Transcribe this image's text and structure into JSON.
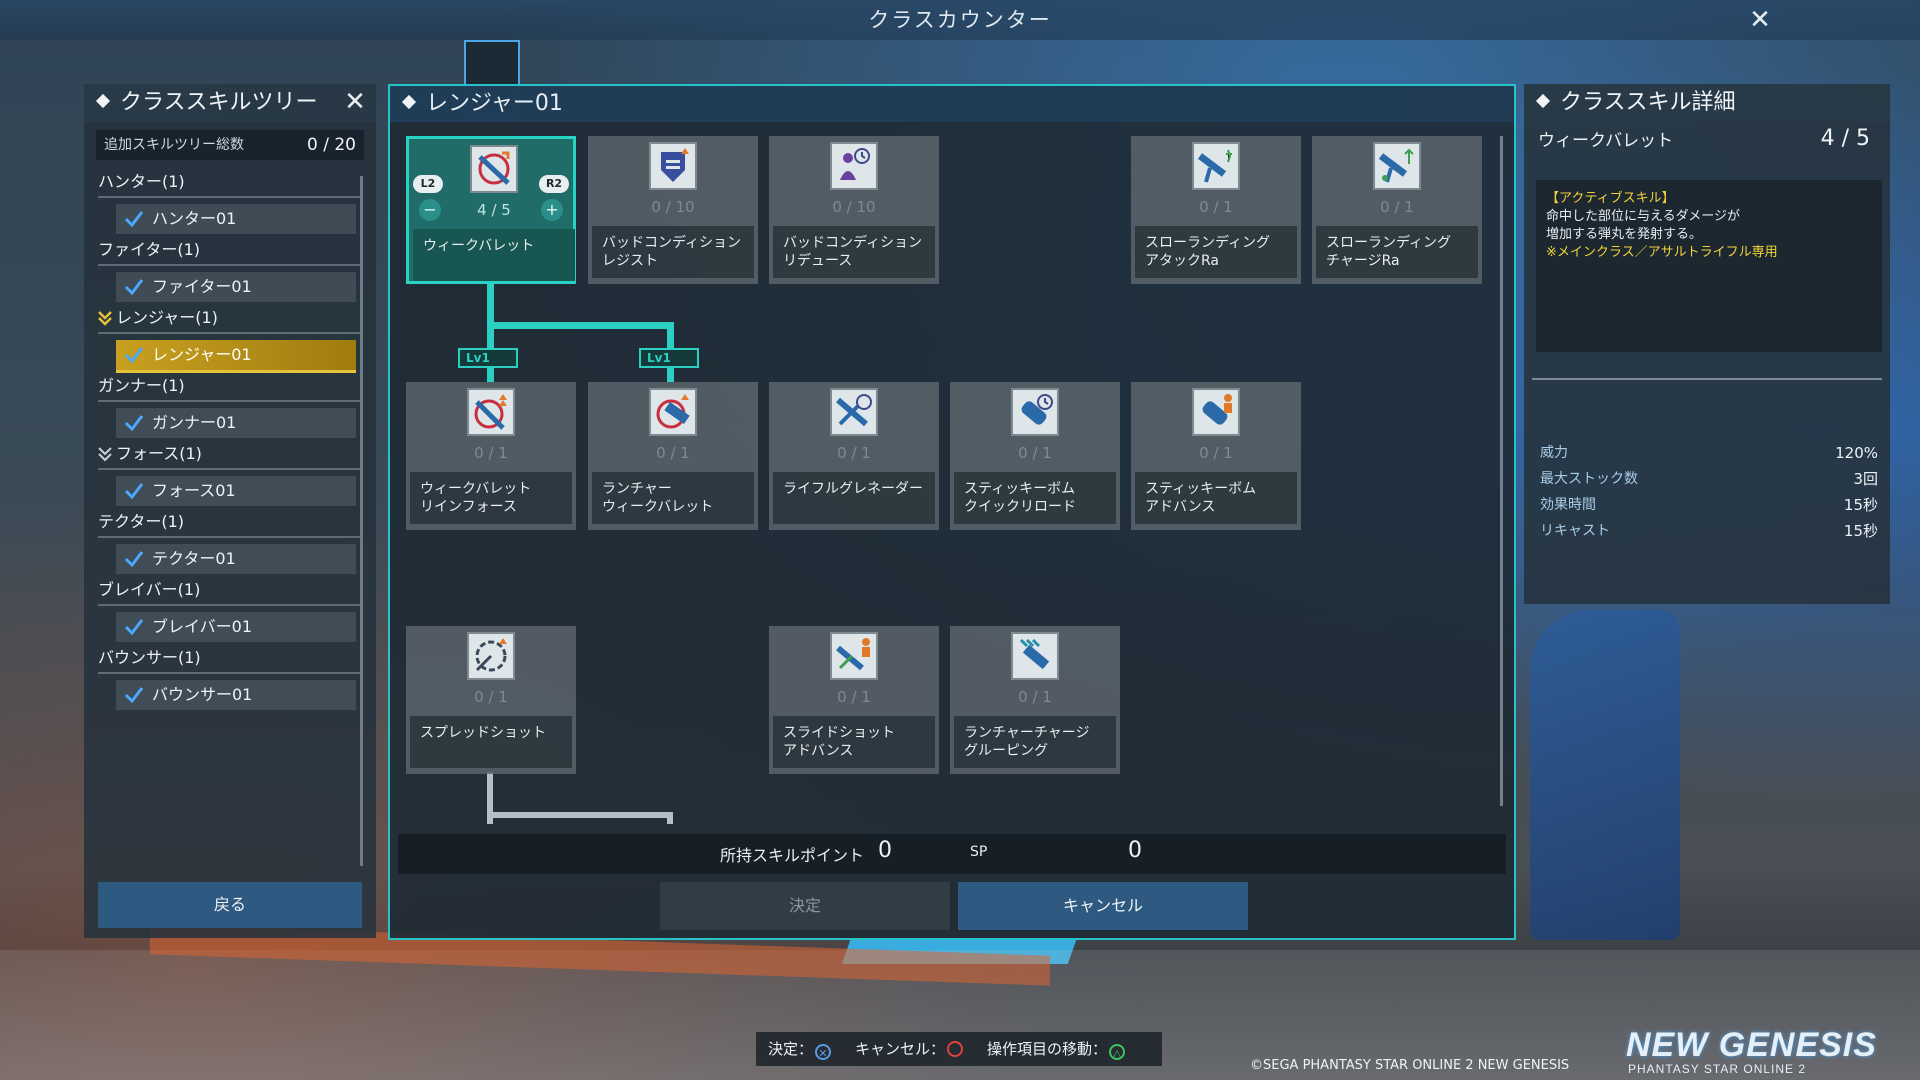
{
  "window": {
    "title": "クラスカウンター",
    "close_glyph": "✕"
  },
  "tree_panel": {
    "title": "クラススキルツリー",
    "close_glyph": "✕",
    "total_label": "追加スキルツリー総数",
    "total_value": "0 / 20",
    "classes": [
      {
        "header": "ハンター(1)",
        "item": "ハンター01"
      },
      {
        "header": "ファイター(1)",
        "item": "ファイター01"
      },
      {
        "header": "レンジャー(1)",
        "item": "レンジャー01"
      },
      {
        "header": "ガンナー(1)",
        "item": "ガンナー01"
      },
      {
        "header": "フォース(1)",
        "item": "フォース01"
      },
      {
        "header": "テクター(1)",
        "item": "テクター01"
      },
      {
        "header": "ブレイバー(1)",
        "item": "ブレイバー01"
      },
      {
        "header": "バウンサー(1)",
        "item": "バウンサー01"
      }
    ],
    "back_label": "戻る"
  },
  "tree": {
    "title": "レンジャー01",
    "nodes": [
      {
        "name_l1": "ウィークバレット",
        "name_l2": "",
        "level": "4 / 5",
        "icon": "weak-bullet-icon"
      },
      {
        "name_l1": "バッドコンディション",
        "name_l2": "レジスト",
        "level": "0 / 10",
        "icon": "shield-badge-icon"
      },
      {
        "name_l1": "バッドコンディション",
        "name_l2": "リデュース",
        "level": "0 / 10",
        "icon": "person-clock-icon"
      },
      {
        "name_l1": "スローランディング",
        "name_l2": "アタックRa",
        "level": "0 / 1",
        "icon": "rifle-sparkle-icon"
      },
      {
        "name_l1": "スローランディング",
        "name_l2": "チャージRa",
        "level": "0 / 1",
        "icon": "rifle-charge-icon"
      },
      {
        "name_l1": "ウィークバレット",
        "name_l2": "リインフォース",
        "level": "0 / 1",
        "icon": "weak-bullet-plus-icon"
      },
      {
        "name_l1": "ランチャー",
        "name_l2": "ウィークバレット",
        "level": "0 / 1",
        "icon": "launcher-bullet-icon"
      },
      {
        "name_l1": "ライフルグレネーダー",
        "name_l2": "",
        "level": "0 / 1",
        "icon": "rifle-grenade-icon"
      },
      {
        "name_l1": "スティッキーボム",
        "name_l2": "クイックリロード",
        "level": "0 / 1",
        "icon": "bomb-clock-icon"
      },
      {
        "name_l1": "スティッキーボム",
        "name_l2": "アドバンス",
        "level": "0 / 1",
        "icon": "bomb-person-icon"
      },
      {
        "name_l1": "スプレッドショット",
        "name_l2": "",
        "level": "0 / 1",
        "icon": "spread-shot-icon"
      },
      {
        "name_l1": "スライドショット",
        "name_l2": "アドバンス",
        "level": "0 / 1",
        "icon": "slide-shot-icon"
      },
      {
        "name_l1": "ランチャーチャージ",
        "name_l2": "グルーピング",
        "level": "0 / 1",
        "icon": "launcher-grouping-icon"
      }
    ],
    "req_tag_1": "Lv1",
    "req_tag_2": "Lv1",
    "l2": "L2",
    "r2": "R2",
    "minus": "−",
    "plus": "+"
  },
  "sp": {
    "label": "所持スキルポイント",
    "value": "0",
    "unit": "SP",
    "value2": "0"
  },
  "buttons": {
    "decide": "決定",
    "cancel": "キャンセル"
  },
  "detail_panel": {
    "title": "クラススキル詳細",
    "skill_name": "ウィークバレット",
    "level": "4 / 5",
    "desc_tag": "【アクティブスキル】",
    "desc_line1": "命中した部位に与えるダメージが",
    "desc_line2": "増加する弾丸を発射する。",
    "desc_note": "※メインクラス／アサルトライフル専用",
    "stats": [
      {
        "key": "威力",
        "value": "120%"
      },
      {
        "key": "最大ストック数",
        "value": "3回"
      },
      {
        "key": "効果時間",
        "value": "15秒"
      },
      {
        "key": "リキャスト",
        "value": "15秒"
      }
    ]
  },
  "hints": {
    "decide": "決定：",
    "cancel": "キャンセル：",
    "move": "操作項目の移動："
  },
  "footer": {
    "copyright": "©SEGA PHANTASY STAR ONLINE 2 NEW GENESIS",
    "logo_main": "NEW GENESIS",
    "logo_sub": "PHANTASY STAR ONLINE 2"
  },
  "colors": {
    "accent": "#27c3c6",
    "selected": "#c8a020",
    "button": "#2e5a82",
    "yellow_text": "#f2d33a"
  }
}
